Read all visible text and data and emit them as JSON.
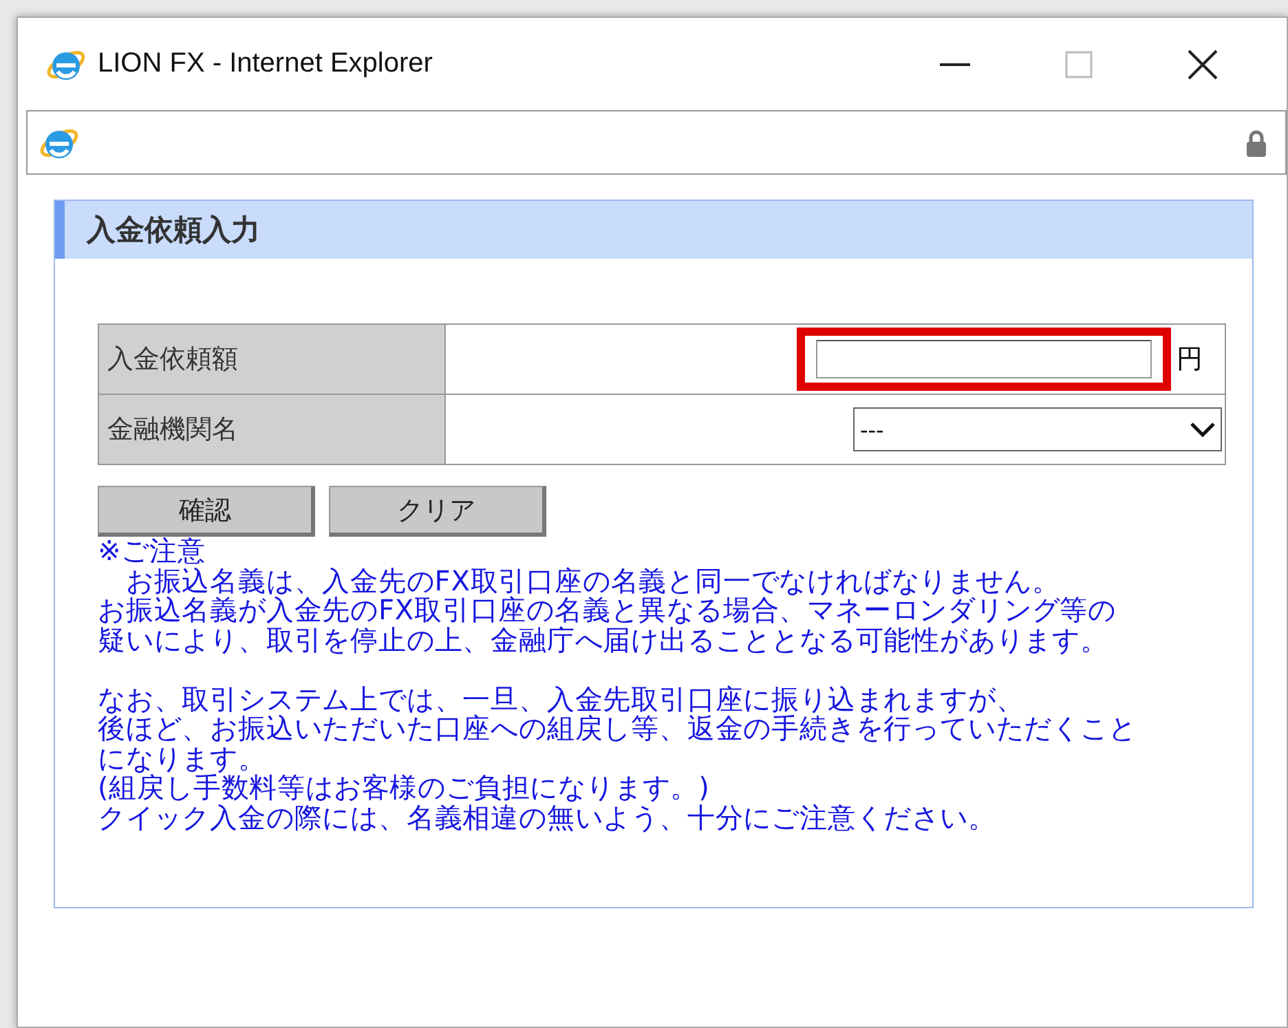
{
  "window": {
    "title": "LION FX - Internet Explorer"
  },
  "panel": {
    "title": "入金依頼入力"
  },
  "form": {
    "rows": [
      {
        "kind": "amount",
        "label": "入金依頼額",
        "value": "",
        "unit": "円",
        "highlighted": true
      },
      {
        "kind": "select",
        "label": "金融機関名",
        "value": "---"
      }
    ]
  },
  "buttons": [
    "確認",
    "クリア"
  ],
  "notes": [
    [
      "※ご注意",
      "　お振込名義は、入金先のFX取引口座の名義と同一でなければなりません。",
      "お振込名義が入金先のFX取引口座の名義と異なる場合、マネーロンダリング等の",
      "疑いにより、取引を停止の上、金融庁へ届け出ることとなる可能性があります。"
    ],
    [
      "なお、取引システム上では、一旦、入金先取引口座に振り込まれますが、",
      "後ほど、お振込いただいた口座への組戻し等、返金の手続きを行っていただくこと",
      "になります。",
      "(組戻し手数料等はお客様のご負担になります。)",
      "クイック入金の際には、名義相違の無いよう、十分にご注意ください。"
    ]
  ]
}
